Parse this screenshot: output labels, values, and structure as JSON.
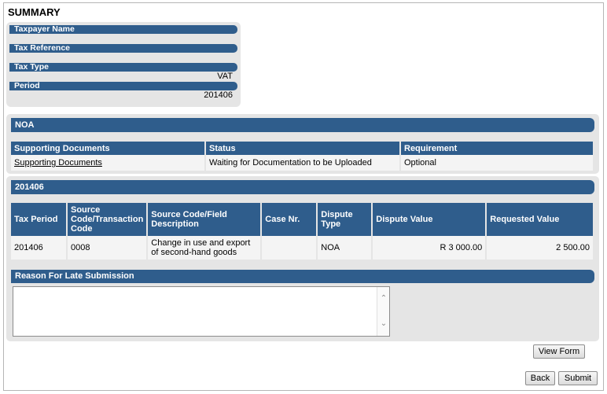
{
  "page": {
    "title": "SUMMARY"
  },
  "summary": {
    "taxpayer_name_label": "Taxpayer Name",
    "taxpayer_name_value": "",
    "tax_reference_label": "Tax Reference",
    "tax_reference_value": "",
    "tax_type_label": "Tax Type",
    "tax_type_value": "VAT",
    "period_label": "Period",
    "period_value": "201406"
  },
  "noa_section": {
    "title": "NOA"
  },
  "supporting_docs": {
    "headers": [
      "Supporting Documents",
      "Status",
      "Requirement"
    ],
    "row": {
      "document": "Supporting Documents",
      "status": "Waiting for Documentation to be Uploaded",
      "requirement": "Optional"
    }
  },
  "period_section": {
    "title": "201406"
  },
  "details": {
    "headers": {
      "tax_period": "Tax Period",
      "source_code_transaction": "Source Code/Transaction Code",
      "source_code_description": "Source Code/Field Description",
      "case_nr": "Case Nr.",
      "dispute_type": "Dispute Type",
      "dispute_value": "Dispute Value",
      "requested_value": "Requested Value"
    },
    "row": {
      "tax_period": "201406",
      "source_code_transaction": "0008",
      "source_code_description": "Change in use and export of second-hand goods",
      "case_nr": "",
      "dispute_type": "NOA",
      "dispute_value": "R 3 000.00",
      "requested_value": "2 500.00"
    }
  },
  "late_submission": {
    "title": "Reason For Late Submission",
    "value": ""
  },
  "buttons": {
    "view_form": "View Form",
    "back": "Back",
    "submit": "Submit"
  },
  "colors": {
    "header_bar": "#2f5d8c",
    "panel_bg": "#e5e5e5",
    "row_bg": "#f4f4f4"
  }
}
